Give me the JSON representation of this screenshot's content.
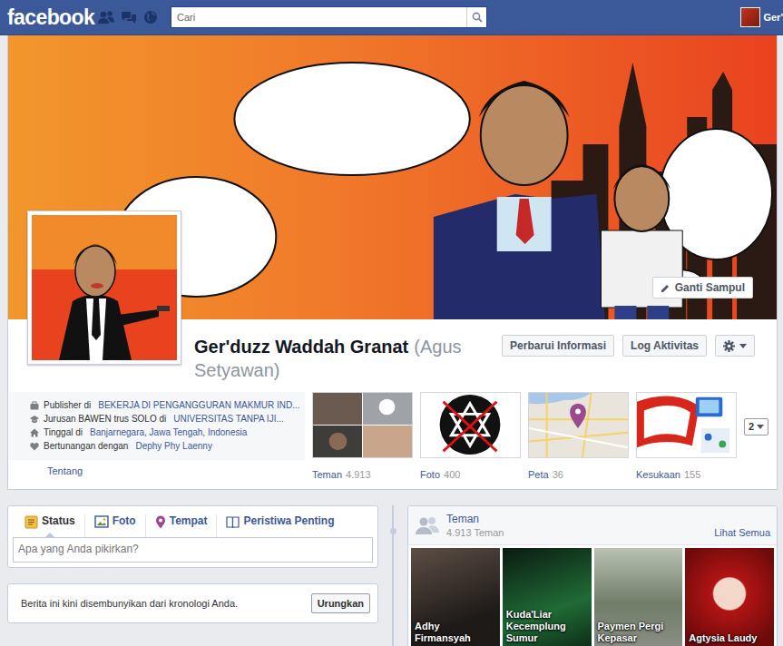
{
  "topbar": {
    "logo": "facebook",
    "search": {
      "placeholder": "Cari"
    },
    "user": "Ger'"
  },
  "cover": {
    "button": "Ganti Sampul"
  },
  "profile": {
    "name": "Ger'duzz Waddah Granat",
    "alt_name": "(Agus Setyawan)",
    "buttons": [
      "Perbarui Informasi",
      "Log Aktivitas"
    ]
  },
  "info": {
    "items": [
      {
        "kind": "work",
        "prefix": "Publisher di",
        "link": "BEKERJA DI PENGANGGURAN MAKMUR IND..."
      },
      {
        "kind": "education",
        "prefix": "Jurusan BAWEN trus SOLO di",
        "link": "UNIVERSITAS TANPA IJI..."
      },
      {
        "kind": "home",
        "prefix": "Tinggal di",
        "link": "Banjarnegara, Jawa Tengah, Indonesia"
      },
      {
        "kind": "relationship",
        "prefix": "Bertunangan dengan",
        "link": "Dephy Phy Laenny"
      }
    ],
    "about": "Tentang"
  },
  "tiles": [
    {
      "kind": "friends",
      "label": "Teman",
      "count": "4.913"
    },
    {
      "kind": "photos",
      "label": "Foto",
      "count": "400"
    },
    {
      "kind": "map",
      "label": "Peta",
      "count": "36"
    },
    {
      "kind": "likes",
      "label": "Kesukaan",
      "count": "155"
    }
  ],
  "more": {
    "count": "2"
  },
  "composer": {
    "tabs": [
      {
        "kind": "status",
        "label": "Status",
        "selected": true
      },
      {
        "kind": "photo",
        "label": "Foto",
        "selected": false
      },
      {
        "kind": "place",
        "label": "Tempat",
        "selected": false
      },
      {
        "kind": "event",
        "label": "Peristiwa Penting",
        "selected": false
      }
    ],
    "placeholder": "Apa yang Anda pikirkan?"
  },
  "notice": {
    "text": "Berita ini kini disembunyikan dari kronologi Anda.",
    "button": "Urungkan"
  },
  "friends": {
    "title": "Teman",
    "count": "4.913 Teman",
    "link": "Lihat Semua",
    "items": [
      {
        "name": "Adhy Firmansyah"
      },
      {
        "name": "Kuda'Liar Kecemplung Sumur"
      },
      {
        "name": "Paymen Pergi Kepasar"
      },
      {
        "name": "Agtysia Laudy"
      }
    ]
  }
}
